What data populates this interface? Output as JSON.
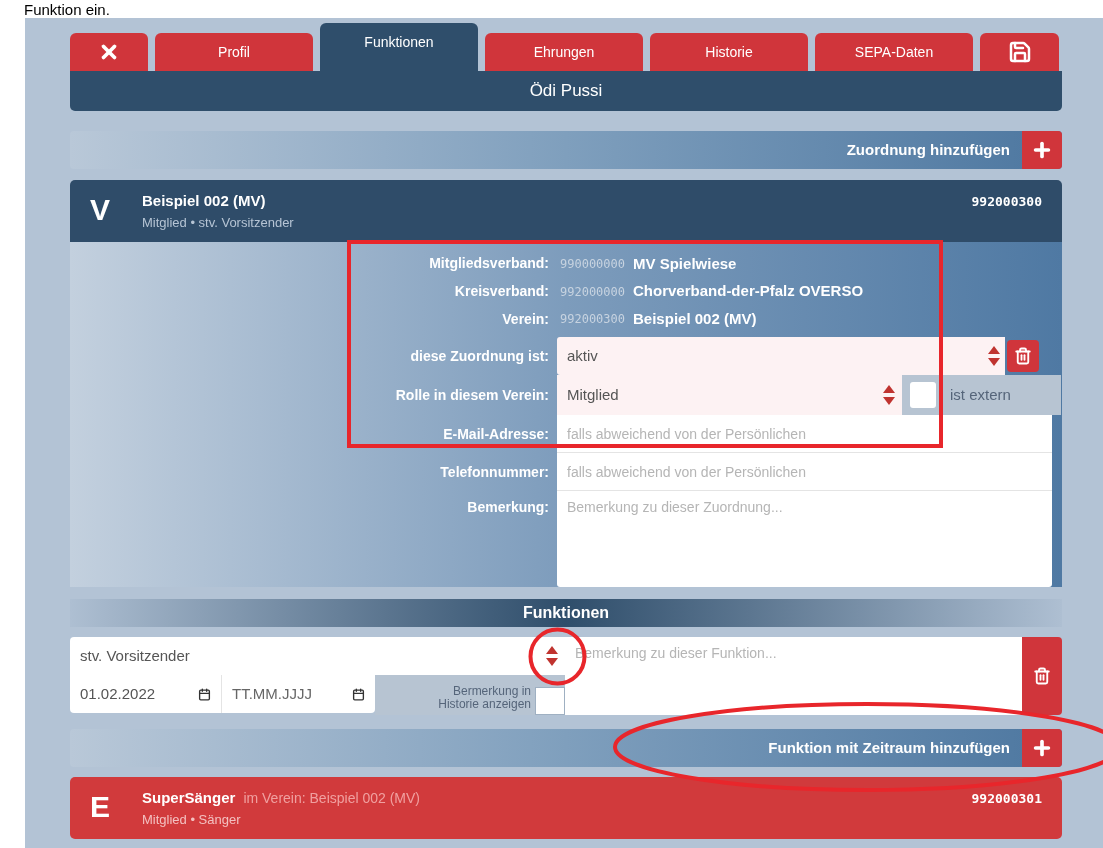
{
  "caption": "Funktion ein.",
  "tabs": [
    {
      "kind": "close",
      "selected": false
    },
    {
      "kind": "text",
      "label": "Profil",
      "selected": false
    },
    {
      "kind": "text",
      "label": "Funktionen",
      "selected": true
    },
    {
      "kind": "text",
      "label": "Ehrungen",
      "selected": false
    },
    {
      "kind": "text",
      "label": "Historie",
      "selected": false
    },
    {
      "kind": "text",
      "label": "SEPA-Daten",
      "selected": false
    },
    {
      "kind": "save",
      "selected": false
    }
  ],
  "person_name": "Ödi Pussi",
  "add_assignment_button": "Zuordnung hinzufügen",
  "assignments": [
    {
      "letter": "V",
      "title": "Beispiel 002 (MV)",
      "subtitle": "Mitglied • stv. Vorsitzender",
      "number": "992000300",
      "color": "#2f4c69",
      "expanded": true,
      "details": {
        "info_rows": [
          {
            "label": "Mitgliedsverband:",
            "code": "990000000",
            "name": "MV Spielwiese"
          },
          {
            "label": "Kreisverband:",
            "code": "992000000",
            "name": "Chorverband-der-Pfalz OVERSO"
          },
          {
            "label": "Verein:",
            "code": "992000300",
            "name": "Beispiel 002 (MV)"
          }
        ],
        "status": {
          "label": "diese Zuordnung ist:",
          "value": "aktiv"
        },
        "role": {
          "label": "Rolle in diesem Verein:",
          "value": "Mitglied",
          "external_label": "ist extern",
          "external_checked": false
        },
        "email": {
          "label": "E-Mail-Adresse:",
          "placeholder": "falls abweichend von der Persönlichen"
        },
        "phone": {
          "label": "Telefonnummer:",
          "placeholder": "falls abweichend von der Persönlichen"
        },
        "remark": {
          "label": "Bemerkung:",
          "placeholder": "Bemerkung zu dieser Zuordnung..."
        },
        "functions_header": "Funktionen",
        "functions": [
          {
            "value": "stv. Vorsitzender",
            "start": "01.02.2022",
            "end_placeholder": "TT.MM.JJJJ",
            "history_label": "Bermerkung in Historie anzeigen",
            "history_checked": false,
            "remark_placeholder": "Bemerkung zu dieser Funktion..."
          }
        ],
        "add_function_button": "Funktion mit Zeitraum hinzufügen"
      }
    },
    {
      "letter": "E",
      "title": "SuperSänger",
      "context": "im Verein: Beispiel 002 (MV)",
      "subtitle": "Mitglied • Sänger",
      "number": "992000301",
      "color": "#d13a3c",
      "expanded": false
    }
  ],
  "annotations": [
    {
      "kind": "rectangle"
    },
    {
      "kind": "circle"
    },
    {
      "kind": "ellipse"
    }
  ]
}
